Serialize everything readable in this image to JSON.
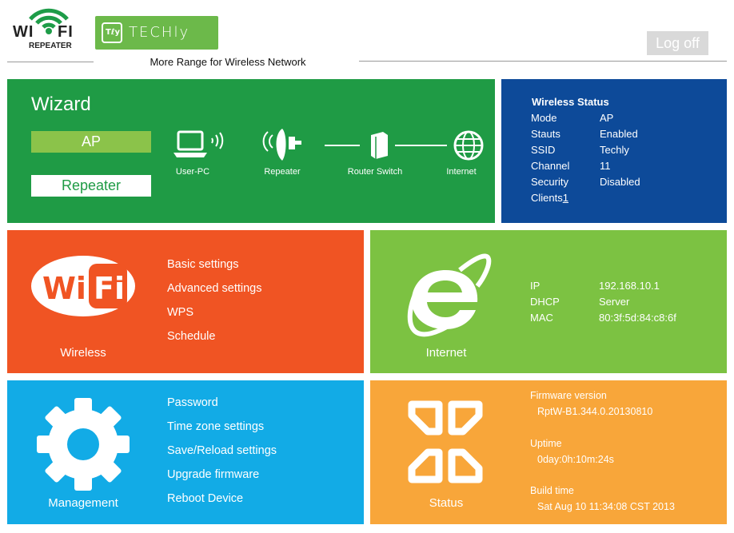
{
  "header": {
    "logo_text": "WI FI",
    "logo_sub": "REPEATER",
    "brand_tag": "Tℓy",
    "brand_name": "TECHly",
    "tagline": "More Range for Wireless Network",
    "logoff_label": "Log off"
  },
  "wizard": {
    "title": "Wizard",
    "ap_label": "AP",
    "repeater_label": "Repeater",
    "diagram": {
      "user_pc": "User-PC",
      "repeater": "Repeater",
      "router": "Router Switch",
      "internet": "Internet"
    }
  },
  "wireless_status": {
    "title": "Wireless Status",
    "rows": [
      {
        "label": "Mode",
        "value": "AP"
      },
      {
        "label": "Stauts",
        "value": "Enabled"
      },
      {
        "label": "SSID",
        "value": "Techly"
      },
      {
        "label": "Channel",
        "value": "11"
      },
      {
        "label": "Security",
        "value": "Disabled"
      }
    ],
    "clients_label": "Clients",
    "clients_count": "1"
  },
  "wireless": {
    "caption": "Wireless",
    "icon_text": "Wi Fi",
    "links": [
      "Basic settings",
      "Advanced settings",
      "WPS",
      "Schedule"
    ]
  },
  "internet": {
    "caption": "Internet",
    "rows": [
      {
        "label": "IP",
        "value": "192.168.10.1"
      },
      {
        "label": "DHCP",
        "value": "Server"
      },
      {
        "label": "MAC",
        "value": "80:3f:5d:84:c8:6f"
      }
    ]
  },
  "management": {
    "caption": "Management",
    "links": [
      "Password",
      "Time zone settings",
      "Save/Reload settings",
      "Upgrade firmware",
      "Reboot Device"
    ]
  },
  "status": {
    "caption": "Status",
    "firmware_label": "Firmware version",
    "firmware_value": "RptW-B1.344.0.20130810",
    "uptime_label": "Uptime",
    "uptime_value": "0day:0h:10m:24s",
    "build_label": "Build time",
    "build_value": "Sat Aug 10 11:34:08 CST 2013"
  },
  "colors": {
    "wizard": "#1f9b45",
    "wireless_status": "#0d4a99",
    "wireless": "#f05423",
    "internet": "#7cc242",
    "management": "#12abe6",
    "status": "#f8a63a"
  }
}
